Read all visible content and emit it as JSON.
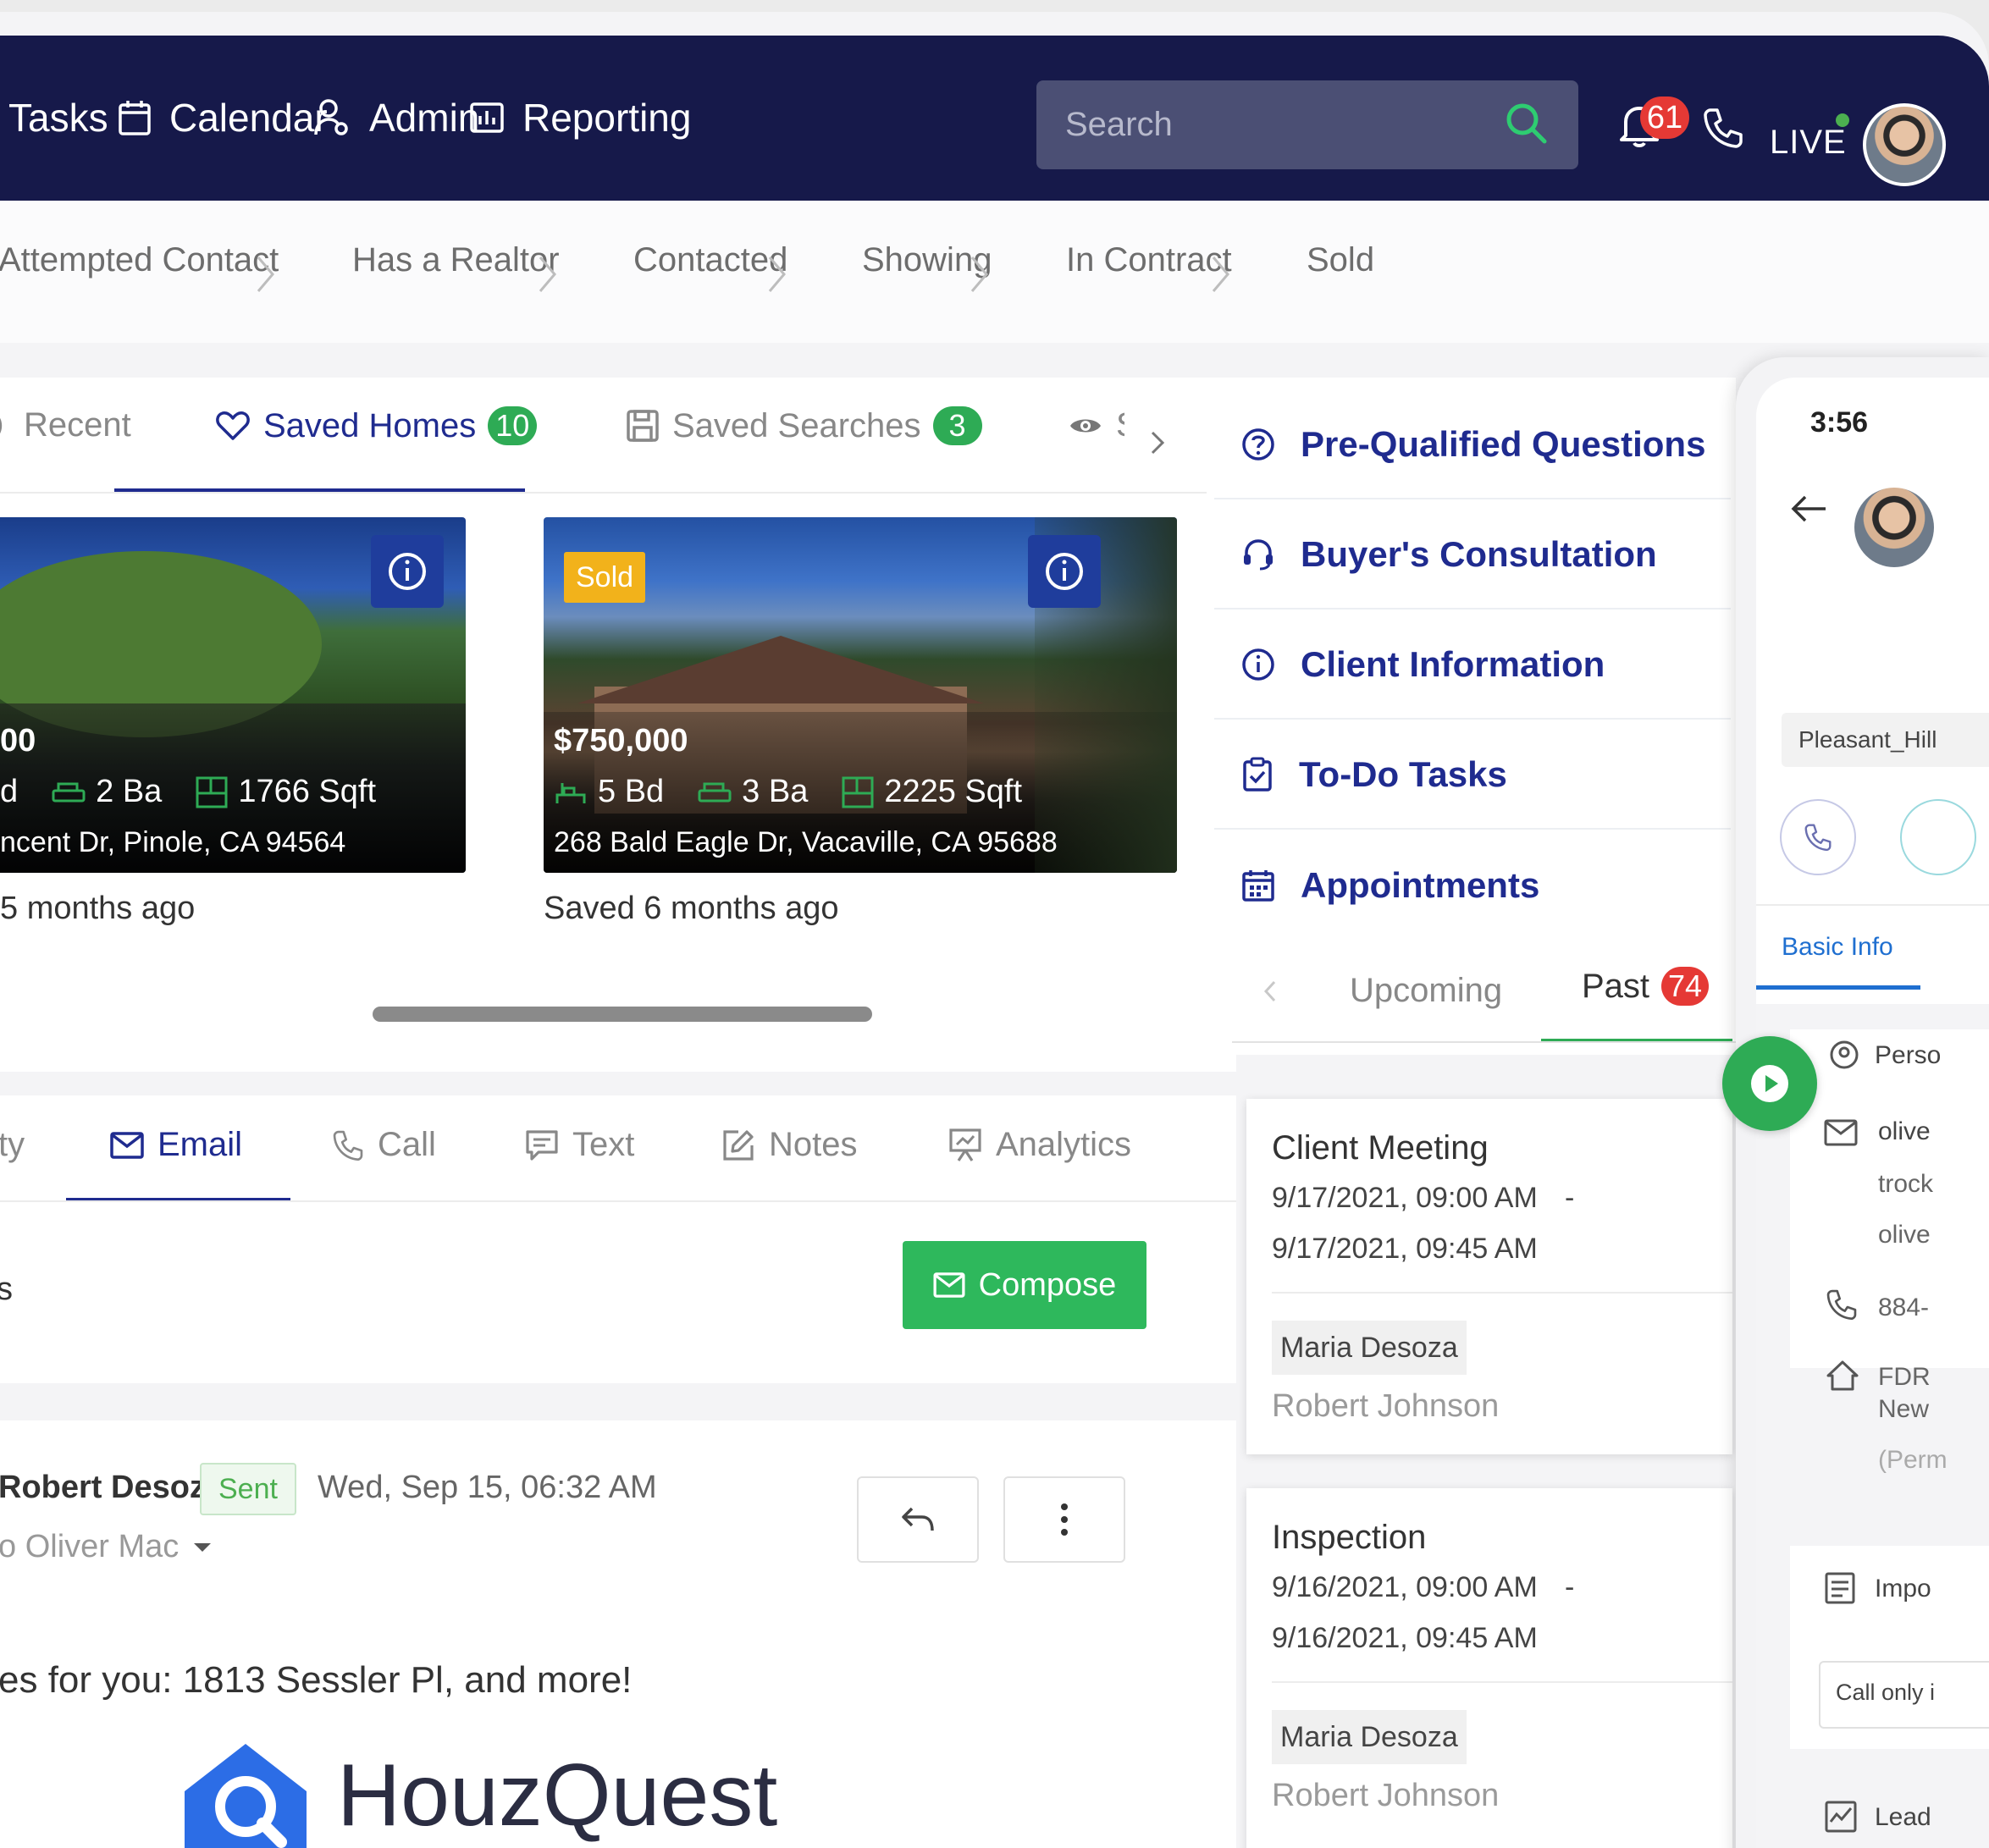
{
  "nav": {
    "items": [
      {
        "label": "Tasks",
        "icon": "tasks-icon"
      },
      {
        "label": "Calendar",
        "icon": "calendar-icon"
      },
      {
        "label": "Admin",
        "icon": "admin-icon"
      },
      {
        "label": "Reporting",
        "icon": "reporting-icon"
      }
    ],
    "search_placeholder": "Search",
    "notification_count": "61",
    "live_label": "LIVE"
  },
  "pipeline": {
    "stages": [
      "Attempted Contact",
      "Has a Realtor",
      "Contacted",
      "Showing",
      "In Contract",
      "Sold"
    ]
  },
  "homes": {
    "tabs": [
      {
        "label": "Recent"
      },
      {
        "label": "Saved Homes",
        "count": "10"
      },
      {
        "label": "Saved Searches",
        "count": "3"
      }
    ],
    "extra_tab_label": "S",
    "properties": [
      {
        "price": "00",
        "beds": "d",
        "baths": "2 Ba",
        "sqft": "1766 Sqft",
        "address": "ncent Dr, Pinole, CA 94564",
        "saved": "5 months ago"
      },
      {
        "status": "Sold",
        "price": "$750,000",
        "beds": "5 Bd",
        "baths": "3 Ba",
        "sqft": "2225 Sqft",
        "address": "268 Bald Eagle Dr, Vacaville, CA 95688",
        "saved": "Saved 6 months ago"
      }
    ]
  },
  "activity": {
    "tabs": [
      "ty",
      "Email",
      "Call",
      "Text",
      "Notes",
      "Analytics"
    ],
    "section_label": "s",
    "compose_label": "Compose",
    "email": {
      "sender": "Robert Desoza",
      "status": "Sent",
      "date": "Wed, Sep 15, 06:32 AM",
      "recipient": "o Oliver Mac",
      "subject_line": "es for you: 1813 Sessler Pl, and more!",
      "logo_text": "HouzQuest"
    }
  },
  "side_menu": {
    "items": [
      {
        "label": "Pre-Qualified Questions",
        "icon": "question-circle-icon"
      },
      {
        "label": "Buyer's Consultation",
        "icon": "headset-icon"
      },
      {
        "label": "Client Information",
        "icon": "info-circle-icon"
      },
      {
        "label": "To-Do Tasks",
        "icon": "clipboard-check-icon"
      },
      {
        "label": "Appointments",
        "icon": "calendar-grid-icon"
      }
    ],
    "appointment_tabs": {
      "upcoming": "Upcoming",
      "past": "Past",
      "past_count": "74"
    },
    "appointments": [
      {
        "title": "Client Meeting",
        "start": "9/17/2021, 09:00 AM",
        "sep": "-",
        "end": "9/17/2021, 09:45 AM",
        "agent": "Maria Desoza",
        "client": "Robert Johnson"
      },
      {
        "title": "Inspection",
        "start": "9/16/2021, 09:00 AM",
        "sep": "-",
        "end": "9/16/2021, 09:45 AM",
        "agent": "Maria Desoza",
        "client": "Robert Johnson"
      }
    ]
  },
  "mobile": {
    "time": "3:56",
    "tag": "Pleasant_Hill",
    "tab": "Basic Info",
    "rows": [
      "Perso",
      "olive",
      "trock",
      "olive",
      "884-",
      "FDR",
      "New",
      "(Perm",
      "Impo",
      "Call only i",
      "Lead"
    ]
  }
}
